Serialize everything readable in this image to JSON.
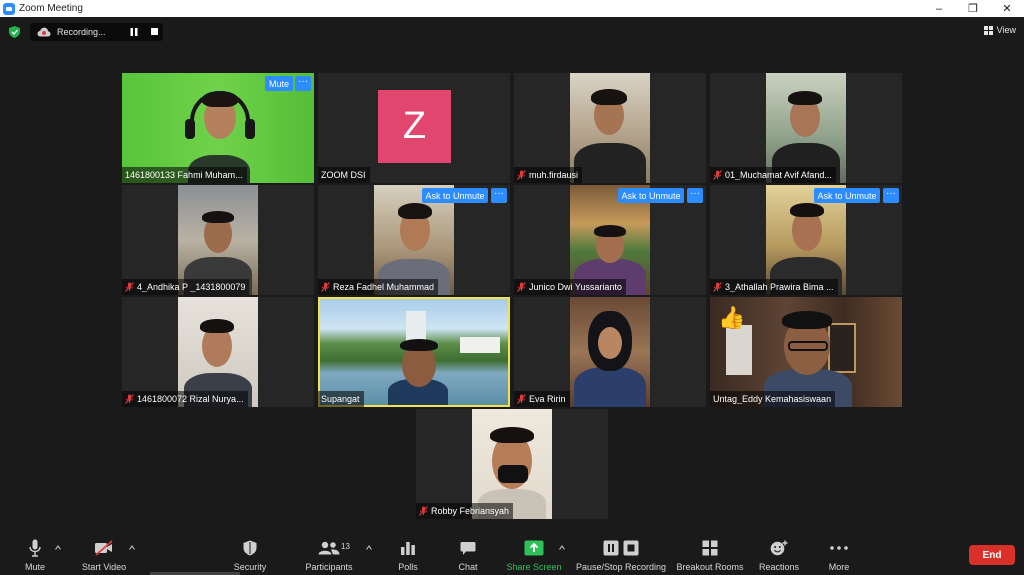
{
  "window": {
    "title": "Zoom Meeting"
  },
  "topbar": {
    "recording_label": "Recording...",
    "view_label": "View"
  },
  "participants": [
    {
      "name": "1461800133 Fahmi Muham...",
      "muted": false,
      "button": "Mute"
    },
    {
      "name": "ZOOM DSI",
      "muted": false,
      "avatar_letter": "Z"
    },
    {
      "name": "muh.firdausi",
      "muted": true
    },
    {
      "name": "01_Muchamat Avif Afand...",
      "muted": true
    },
    {
      "name": "4_Andhika P _1431800079",
      "muted": true
    },
    {
      "name": "Reza Fadhel Muhammad",
      "muted": true,
      "button": "Ask to Unmute"
    },
    {
      "name": "Junico Dwi Yussarianto",
      "muted": true,
      "button": "Ask to Unmute"
    },
    {
      "name": "3_Athallah Prawira Bima ...",
      "muted": true,
      "button": "Ask to Unmute"
    },
    {
      "name": "1461800072 Rizal Nurya...",
      "muted": true
    },
    {
      "name": "Supangat",
      "muted": false,
      "active_speaker": true
    },
    {
      "name": "Eva Ririn",
      "muted": true
    },
    {
      "name": "Untag_Eddy Kemahasiswaan",
      "muted": false
    },
    {
      "name": "Robby Febriansyah",
      "muted": true
    }
  ],
  "more_dots": "···",
  "toolbar": {
    "mute": "Mute",
    "start_video": "Start Video",
    "security": "Security",
    "participants": "Participants",
    "participants_count": "13",
    "polls": "Polls",
    "chat": "Chat",
    "share_screen": "Share Screen",
    "pause_stop_recording": "Pause/Stop Recording",
    "breakout_rooms": "Breakout Rooms",
    "reactions": "Reactions",
    "more": "More",
    "end": "End"
  },
  "colors": {
    "accent_blue": "#2d8cff",
    "share_green": "#2ec15a",
    "end_red": "#d9312a",
    "active_speaker": "#f3e34a",
    "avatar_pink": "#e0466e",
    "muted_red": "#e03c3c"
  },
  "icons": {
    "shield": "shield-check-icon",
    "recording": "cloud-recording-icon",
    "view": "grid-view-icon",
    "mute": "microphone-icon",
    "video": "video-off-icon",
    "security": "shield-icon",
    "participants": "people-icon",
    "polls": "bar-chart-icon",
    "chat": "chat-bubble-icon",
    "share": "share-screen-icon",
    "recording_controls": "pause-stop-icon",
    "breakout": "grid-rooms-icon",
    "reactions": "emoji-add-icon",
    "more": "ellipsis-icon"
  }
}
